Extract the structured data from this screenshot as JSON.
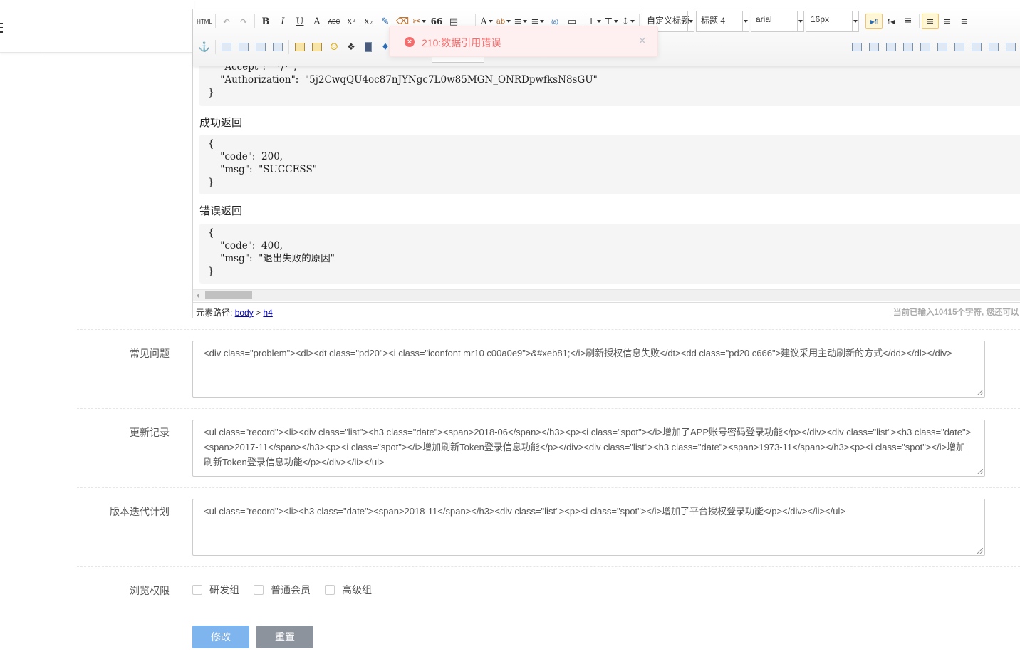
{
  "toolbar": {
    "row1": [
      "HTML",
      "↶",
      "↷",
      "B",
      "I",
      "U",
      "A",
      "ABC",
      "X²",
      "X₂",
      "✎",
      "⌫",
      "✂",
      "66",
      "▤",
      "A",
      "ab",
      "≡",
      "≡",
      "(a)",
      "▭",
      "⊥",
      "⊤",
      "↕"
    ],
    "combos": [
      {
        "value": "自定义标题"
      },
      {
        "value": "标题 4"
      },
      {
        "value": "arial"
      },
      {
        "value": "16px"
      }
    ],
    "row1_tail": [
      "▶¶",
      "¶◀",
      "≣",
      "≡",
      "≡",
      "≡"
    ]
  },
  "editor": {
    "code_top": "    \"Accept\":  \"*/*\",\n    \"Authorization\":  \"5j2CwqQU4oc87nJYNgc7L0w85MGN_ONRDpwfksN8sGU\"\n}",
    "section_success": "成功返回",
    "code_success": "{\n    \"code\":  200,\n    \"msg\":  \"SUCCESS\"\n}",
    "section_error": "错误返回",
    "code_error": "{\n    \"code\":  400,\n    \"msg\":  \"退出失败的原因\"\n}",
    "path_label": "元素路径:",
    "path_body": "body",
    "path_sep": ">",
    "path_h4": "h4",
    "word_count": "当前已输入10415个字符, 您还可以"
  },
  "toast": {
    "icon": "×",
    "message": "210:数据引用错误",
    "close": "×"
  },
  "form": {
    "faq_label": "常见问题",
    "faq_value": "<div class=\"problem\"><dl><dt class=\"pd20\"><i class=\"iconfont mr10 c00a0e9\">&#xeb81;</i>刷新授权信息失败</dt><dd class=\"pd20 c666\">建议采用主动刷新的方式</dd></dl></div>",
    "changelog_label": "更新记录",
    "changelog_value": "<ul class=\"record\"><li><div class=\"list\"><h3 class=\"date\"><span>2018-06</span></h3><p><i class=\"spot\"></i>增加了APP账号密码登录功能</p></div><div class=\"list\"><h3 class=\"date\"><span>2017-11</span></h3><p><i class=\"spot\"></i>增加刷新Token登录信息功能</p></div><div class=\"list\"><h3 class=\"date\"><span>1973-11</span></h3><p><i class=\"spot\"></i>增加刷新Token登录信息功能</p></div></li></ul>",
    "roadmap_label": "版本迭代计划",
    "roadmap_value": "<ul class=\"record\"><li><h3 class=\"date\"><span>2018-11</span></h3><div class=\"list\"><p><i class=\"spot\"></i>增加了平台授权登录功能</p></div></li></ul>",
    "permission_label": "浏览权限",
    "permissions": [
      "研发组",
      "普通会员",
      "高级组"
    ],
    "submit": "修改",
    "reset": "重置"
  },
  "colors": {
    "primary_button": "#7fb5ee",
    "reset_button": "#8c939d",
    "toast_bg": "#fef0f0",
    "toast_text": "#f56c6c"
  }
}
